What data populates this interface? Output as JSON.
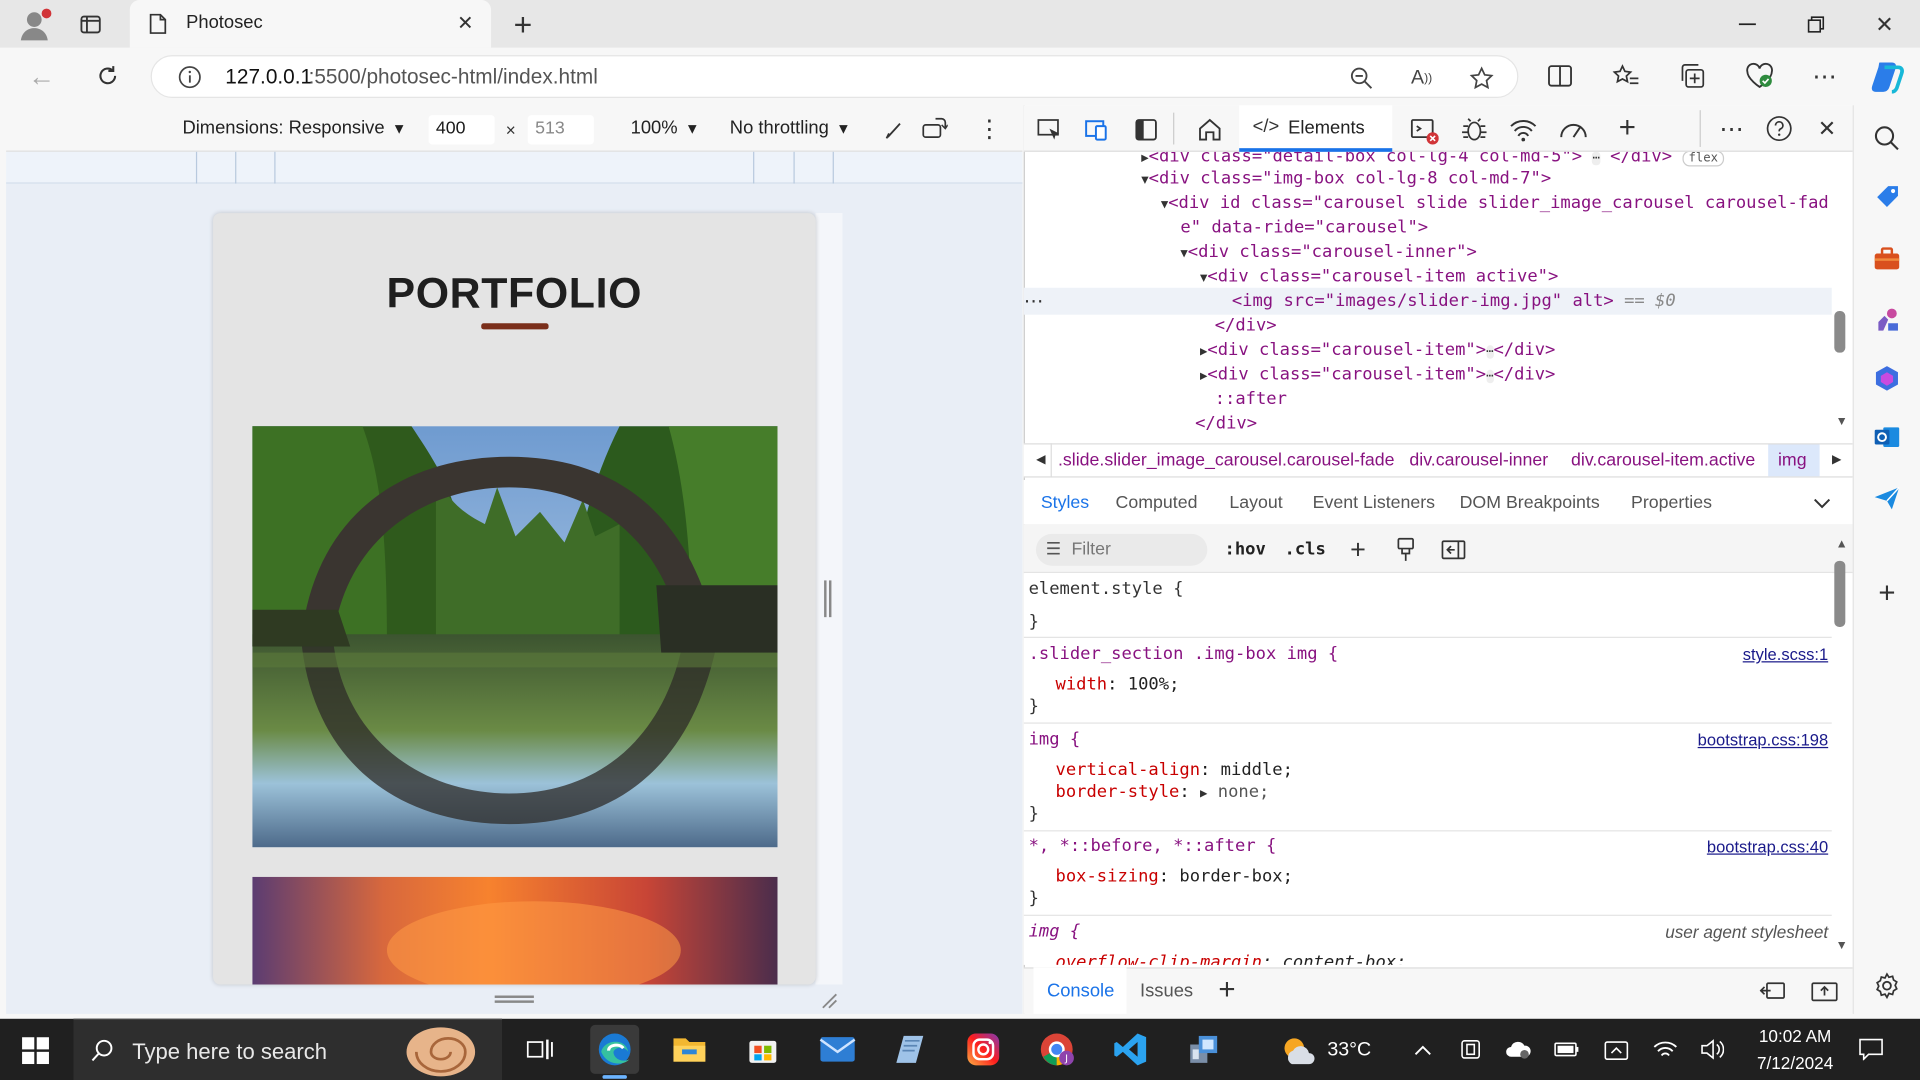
{
  "browser": {
    "tab_title": "Photosec",
    "url_host": "127.0.0.1",
    "url_path": ":5500/photosec-html/index.html",
    "new_tab_glyph": "+"
  },
  "device_toolbar": {
    "dimensions_label": "Dimensions: Responsive",
    "width": "400",
    "times": "×",
    "height": "513",
    "zoom": "100%",
    "throttling": "No throttling"
  },
  "page": {
    "heading": "PORTFOLIO",
    "accent_color": "#7a2e1a"
  },
  "devtools": {
    "panel_tab": "Elements",
    "dom_lines": [
      {
        "text": "<div class=\"detail-box col-lg-4 col-md-5\">",
        "badge": "flex"
      },
      {
        "text": "<div class=\"img-box col-lg-8 col-md-7\">"
      },
      {
        "text": "<div id class=\"carousel slide slider_image_carousel carousel-fad"
      },
      {
        "text": "e\" data-ride=\"carousel\">"
      },
      {
        "text": "<div class=\"carousel-inner\">"
      },
      {
        "text": "<div class=\"carousel-item active\">"
      },
      {
        "text": "<img src=\"images/slider-img.jpg\" alt>",
        "suffix": "== $0"
      },
      {
        "text": "</div>"
      },
      {
        "text": "<div class=\"carousel-item\">",
        "close": "</div>"
      },
      {
        "text": "<div class=\"carousel-item\">",
        "close": "</div>"
      },
      {
        "text": "::after"
      },
      {
        "text": "</div>"
      }
    ],
    "breadcrumbs": [
      ".slide.slider_image_carousel.carousel-fade",
      "div.carousel-inner",
      "div.carousel-item.active",
      "img"
    ],
    "subtabs": [
      "Styles",
      "Computed",
      "Layout",
      "Event Listeners",
      "DOM Breakpoints",
      "Properties"
    ],
    "filter_placeholder": "Filter",
    "hov": ":hov",
    "cls": ".cls",
    "rules": [
      {
        "selector": "element.style {",
        "decls": [],
        "source": ""
      },
      {
        "selector": ".slider_section .img-box img {",
        "decls": [
          [
            "width",
            "100%;"
          ]
        ],
        "source": "style.scss:1"
      },
      {
        "selector": "img {",
        "decls": [
          [
            "vertical-align",
            "middle;"
          ],
          [
            "border-style",
            "none;"
          ]
        ],
        "source": "bootstrap.css:198"
      },
      {
        "selector": "*, *::before, *::after {",
        "decls": [
          [
            "box-sizing",
            "border-box;"
          ]
        ],
        "source": "bootstrap.css:40"
      },
      {
        "selector": "img {",
        "decls": [
          [
            "overflow-clip-margin",
            "content-box;"
          ]
        ],
        "source": "user agent stylesheet"
      }
    ],
    "drawer_tabs": [
      "Console",
      "Issues"
    ]
  },
  "taskbar": {
    "search_placeholder": "Type here to search",
    "weather": "33°C",
    "time": "10:02 AM",
    "date": "7/12/2024"
  }
}
